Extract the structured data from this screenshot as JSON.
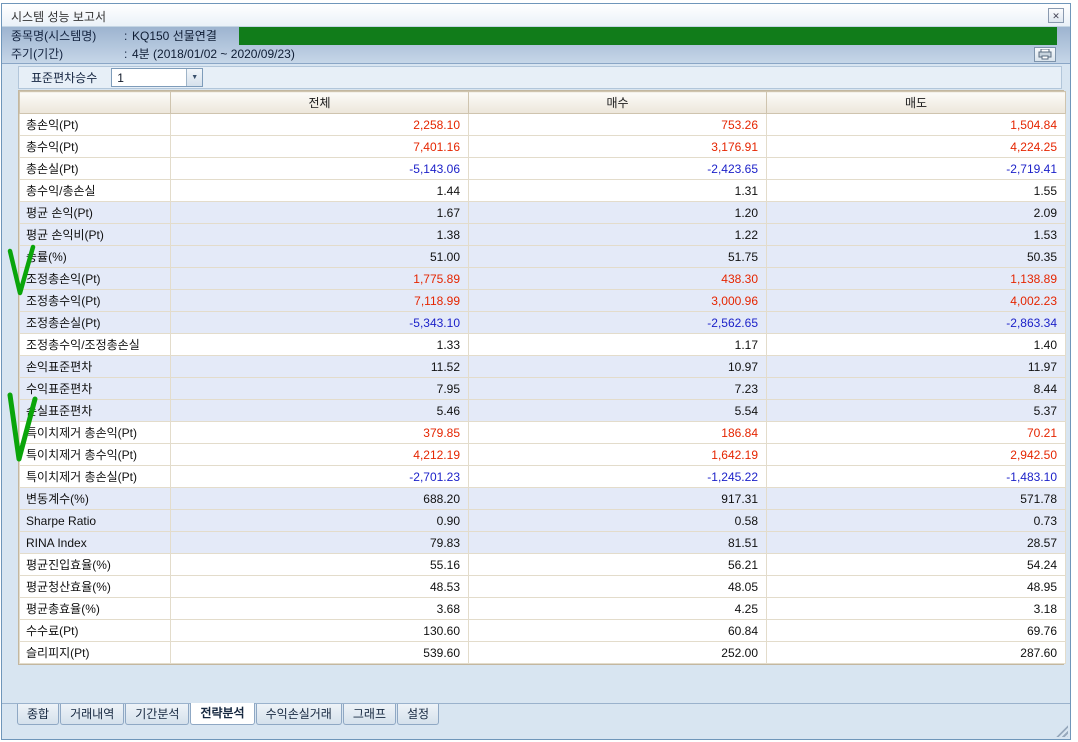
{
  "window": {
    "title": "시스템 성능 보고서",
    "close_glyph": "✕"
  },
  "header": {
    "item_label": "종목명(시스템명)",
    "item_sep": ":",
    "item_value": "KQ150 선물연결",
    "period_label": "주기(기간)",
    "period_sep": ":",
    "period_value": "4분 (2018/01/02 ~ 2020/09/23)"
  },
  "toolbar": {
    "stddev_label": "표준편차승수",
    "stddev_value": "1",
    "dropdown_glyph": "▼"
  },
  "table": {
    "columns": [
      "",
      "전체",
      "매수",
      "매도"
    ],
    "rows": [
      {
        "label": "총손익(Pt)",
        "values": [
          "2,258.10",
          "753.26",
          "1,504.84"
        ],
        "tone": "pos",
        "band": "a"
      },
      {
        "label": "총수익(Pt)",
        "values": [
          "7,401.16",
          "3,176.91",
          "4,224.25"
        ],
        "tone": "pos",
        "band": "a"
      },
      {
        "label": "총손실(Pt)",
        "values": [
          "-5,143.06",
          "-2,423.65",
          "-2,719.41"
        ],
        "tone": "neg",
        "band": "a"
      },
      {
        "label": "총수익/총손실",
        "values": [
          "1.44",
          "1.31",
          "1.55"
        ],
        "tone": "plain",
        "band": "a"
      },
      {
        "label": "평균 손익(Pt)",
        "values": [
          "1.67",
          "1.20",
          "2.09"
        ],
        "tone": "plain",
        "band": "b"
      },
      {
        "label": "평균 손익비(Pt)",
        "values": [
          "1.38",
          "1.22",
          "1.53"
        ],
        "tone": "plain",
        "band": "b"
      },
      {
        "label": "승률(%)",
        "values": [
          "51.00",
          "51.75",
          "50.35"
        ],
        "tone": "plain",
        "band": "b"
      },
      {
        "label": "조정총손익(Pt)",
        "values": [
          "1,775.89",
          "438.30",
          "1,138.89"
        ],
        "tone": "pos",
        "band": "b"
      },
      {
        "label": "조정총수익(Pt)",
        "values": [
          "7,118.99",
          "3,000.96",
          "4,002.23"
        ],
        "tone": "pos",
        "band": "b"
      },
      {
        "label": "조정총손실(Pt)",
        "values": [
          "-5,343.10",
          "-2,562.65",
          "-2,863.34"
        ],
        "tone": "neg",
        "band": "b"
      },
      {
        "label": "조정총수익/조정총손실",
        "values": [
          "1.33",
          "1.17",
          "1.40"
        ],
        "tone": "plain",
        "band": "a"
      },
      {
        "label": "손익표준편차",
        "values": [
          "11.52",
          "10.97",
          "11.97"
        ],
        "tone": "plain",
        "band": "b"
      },
      {
        "label": "수익표준편차",
        "values": [
          "7.95",
          "7.23",
          "8.44"
        ],
        "tone": "plain",
        "band": "b"
      },
      {
        "label": "손실표준편차",
        "values": [
          "5.46",
          "5.54",
          "5.37"
        ],
        "tone": "plain",
        "band": "b"
      },
      {
        "label": "특이치제거 총손익(Pt)",
        "values": [
          "379.85",
          "186.84",
          "70.21"
        ],
        "tone": "pos",
        "band": "a"
      },
      {
        "label": "특이치제거 총수익(Pt)",
        "values": [
          "4,212.19",
          "1,642.19",
          "2,942.50"
        ],
        "tone": "pos",
        "band": "a"
      },
      {
        "label": "특이치제거 총손실(Pt)",
        "values": [
          "-2,701.23",
          "-1,245.22",
          "-1,483.10"
        ],
        "tone": "neg",
        "band": "a"
      },
      {
        "label": "변동계수(%)",
        "values": [
          "688.20",
          "917.31",
          "571.78"
        ],
        "tone": "plain",
        "band": "b"
      },
      {
        "label": "Sharpe Ratio",
        "values": [
          "0.90",
          "0.58",
          "0.73"
        ],
        "tone": "plain",
        "band": "b"
      },
      {
        "label": "RINA Index",
        "values": [
          "79.83",
          "81.51",
          "28.57"
        ],
        "tone": "plain",
        "band": "b"
      },
      {
        "label": "평균진입효율(%)",
        "values": [
          "55.16",
          "56.21",
          "54.24"
        ],
        "tone": "plain",
        "band": "a"
      },
      {
        "label": "평균청산효율(%)",
        "values": [
          "48.53",
          "48.05",
          "48.95"
        ],
        "tone": "plain",
        "band": "a"
      },
      {
        "label": "평균총효율(%)",
        "values": [
          "3.68",
          "4.25",
          "3.18"
        ],
        "tone": "plain",
        "band": "a"
      },
      {
        "label": "수수료(Pt)",
        "values": [
          "130.60",
          "60.84",
          "69.76"
        ],
        "tone": "plain",
        "band": "a"
      },
      {
        "label": "슬리피지(Pt)",
        "values": [
          "539.60",
          "252.00",
          "287.60"
        ],
        "tone": "plain",
        "band": "a"
      }
    ]
  },
  "tabs": [
    {
      "label": "종합",
      "state": "normal"
    },
    {
      "label": "거래내역",
      "state": "normal"
    },
    {
      "label": "기간분석",
      "state": "normal"
    },
    {
      "label": "전략분석",
      "state": "active"
    },
    {
      "label": "수익손실거래",
      "state": "normal"
    },
    {
      "label": "그래프",
      "state": "normal"
    },
    {
      "label": "설정",
      "state": "normal"
    }
  ],
  "annotations": {
    "bar_style": "background:#117c1a",
    "stroke": "#0aa50a"
  },
  "colors": {
    "profit": "#e52500",
    "loss": "#1a1fc8",
    "row_stripe": "#e4eaf8",
    "header_blue": "#a9bed8"
  }
}
